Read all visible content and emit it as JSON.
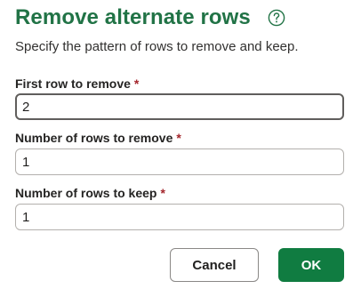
{
  "dialog": {
    "title": "Remove alternate rows",
    "help_icon": "help-circle-icon",
    "subtitle": "Specify the pattern of rows to remove and keep.",
    "required_marker": "*",
    "fields": [
      {
        "label": "First row to remove",
        "value": "2"
      },
      {
        "label": "Number of rows to remove",
        "value": "1"
      },
      {
        "label": "Number of rows to keep",
        "value": "1"
      }
    ],
    "buttons": {
      "cancel_label": "Cancel",
      "ok_label": "OK"
    },
    "colors": {
      "title": "#217346",
      "primary_button": "#107c41",
      "required_marker": "#a4262c"
    }
  }
}
